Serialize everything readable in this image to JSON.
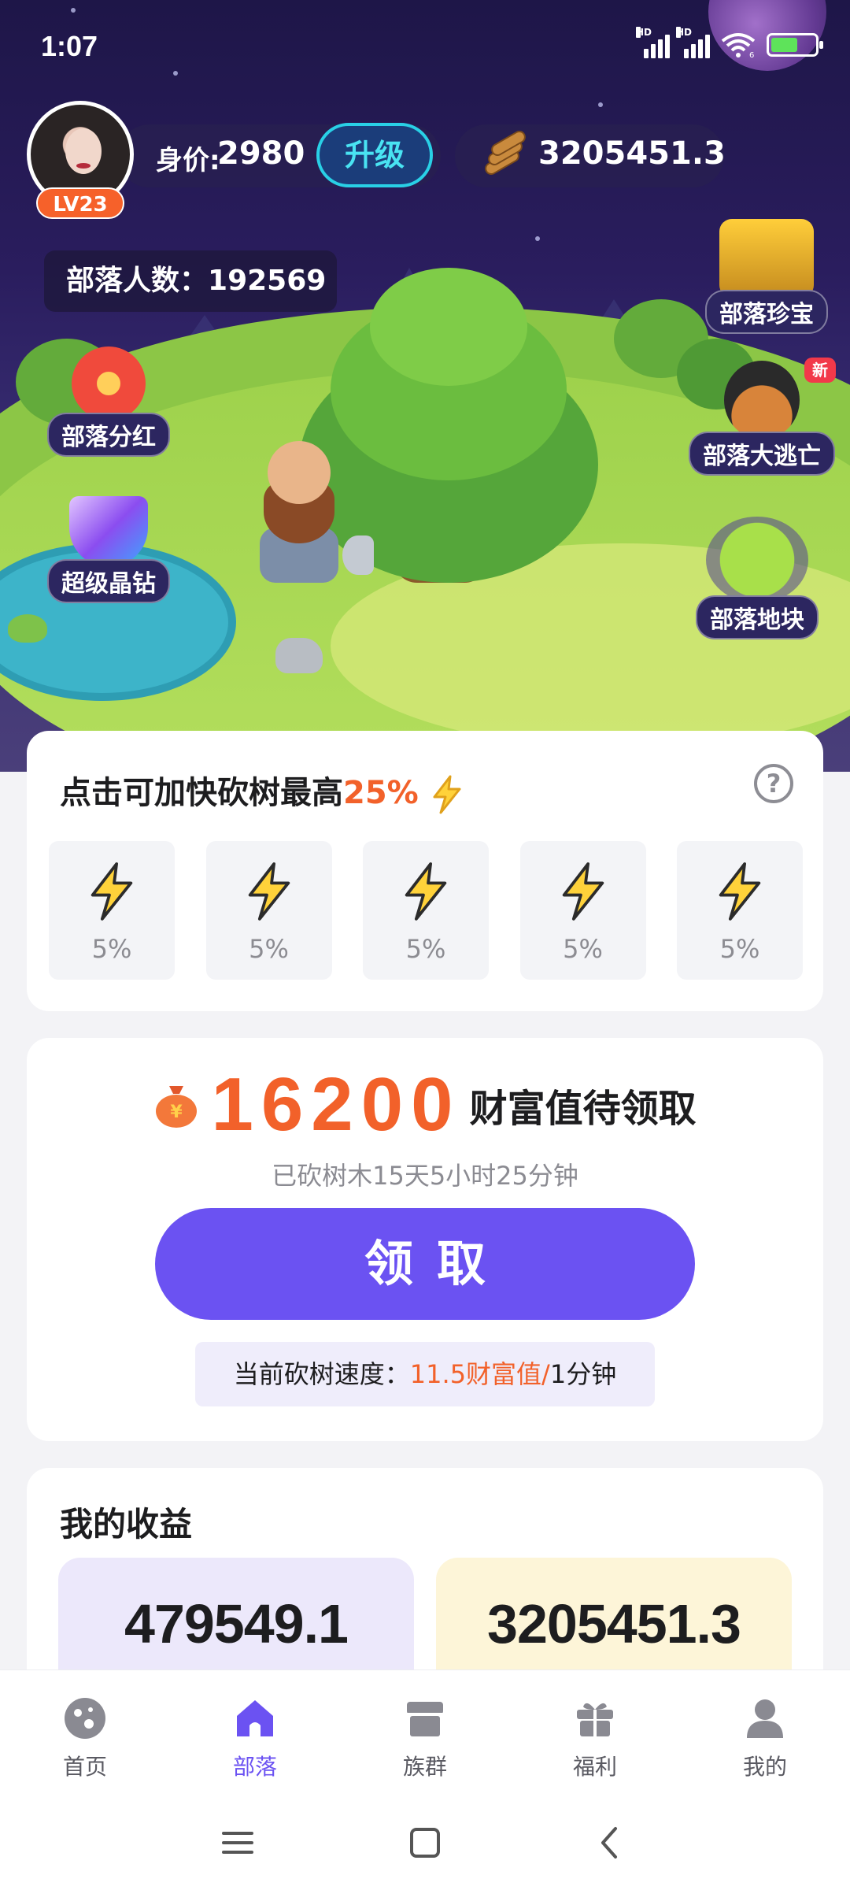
{
  "status": {
    "time": "1:07",
    "network_labels": [
      "HD",
      "HD"
    ],
    "network_sublabel": "6"
  },
  "profile": {
    "level": "LV23",
    "value_label": "身价:",
    "value": "2980",
    "upgrade_label": "升级",
    "wood": "3205451.3",
    "tribe_count_label": "部落人数：",
    "tribe_count": "192569"
  },
  "scene_buttons": {
    "treasure": "部落珍宝",
    "dividend": "部落分红",
    "escape": "部落大逃亡",
    "escape_tag": "新",
    "diamond": "超级晶钻",
    "land": "部落地块"
  },
  "boost": {
    "title_prefix": "点击可加快砍树最高",
    "title_highlight": "25%",
    "help": "?",
    "tiles": [
      "5%",
      "5%",
      "5%",
      "5%",
      "5%"
    ]
  },
  "claim": {
    "amount": "16200",
    "amount_suffix": "财富值待领取",
    "chopped_time": "已砍树木15天5小时25分钟",
    "button": "领取",
    "speed_prefix": "当前砍树速度：",
    "speed_value": "11.5财富值/",
    "speed_suffix": "1分钟"
  },
  "earnings": {
    "title": "我的收益",
    "left_value": "479549.1",
    "right_value": "3205451.3"
  },
  "nav": {
    "items": [
      {
        "label": "首页",
        "icon": "planet-icon"
      },
      {
        "label": "部落",
        "icon": "home-icon"
      },
      {
        "label": "族群",
        "icon": "store-icon"
      },
      {
        "label": "福利",
        "icon": "gift-icon"
      },
      {
        "label": "我的",
        "icon": "user-icon"
      }
    ],
    "active_index": 1
  },
  "colors": {
    "accent": "#6b52f2",
    "highlight": "#f2612a",
    "scene_sky": "#2a1d5e"
  }
}
